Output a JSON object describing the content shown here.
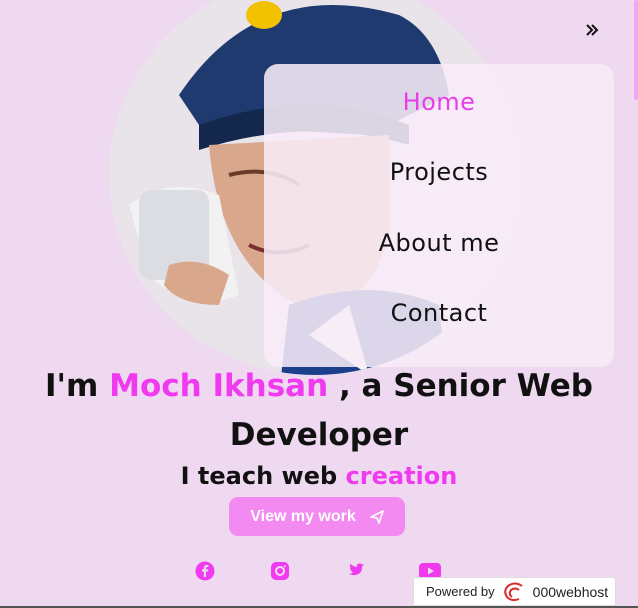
{
  "nav": {
    "toggle_icon": "chevron-double-right",
    "items": [
      {
        "label": "Home",
        "active": true
      },
      {
        "label": "Projects",
        "active": false
      },
      {
        "label": "About me",
        "active": false
      },
      {
        "label": "Contact",
        "active": false
      }
    ]
  },
  "hero": {
    "headline_prefix": "I'm ",
    "name": "Moch Ikhsan",
    "headline_suffix": " , a Senior Web Developer",
    "sub_prefix": "I teach web ",
    "sub_accent": "creation",
    "cta_label": "View my work",
    "cta_icon": "send-icon"
  },
  "social": [
    "facebook-icon",
    "instagram-icon",
    "twitter-icon",
    "youtube-icon"
  ],
  "badge": {
    "powered_by": "Powered by",
    "brand": "000webhost"
  },
  "colors": {
    "background": "#efd9f0",
    "accent": "#f03af0",
    "button": "#f28af2",
    "nav_active": "#e83ee8"
  }
}
